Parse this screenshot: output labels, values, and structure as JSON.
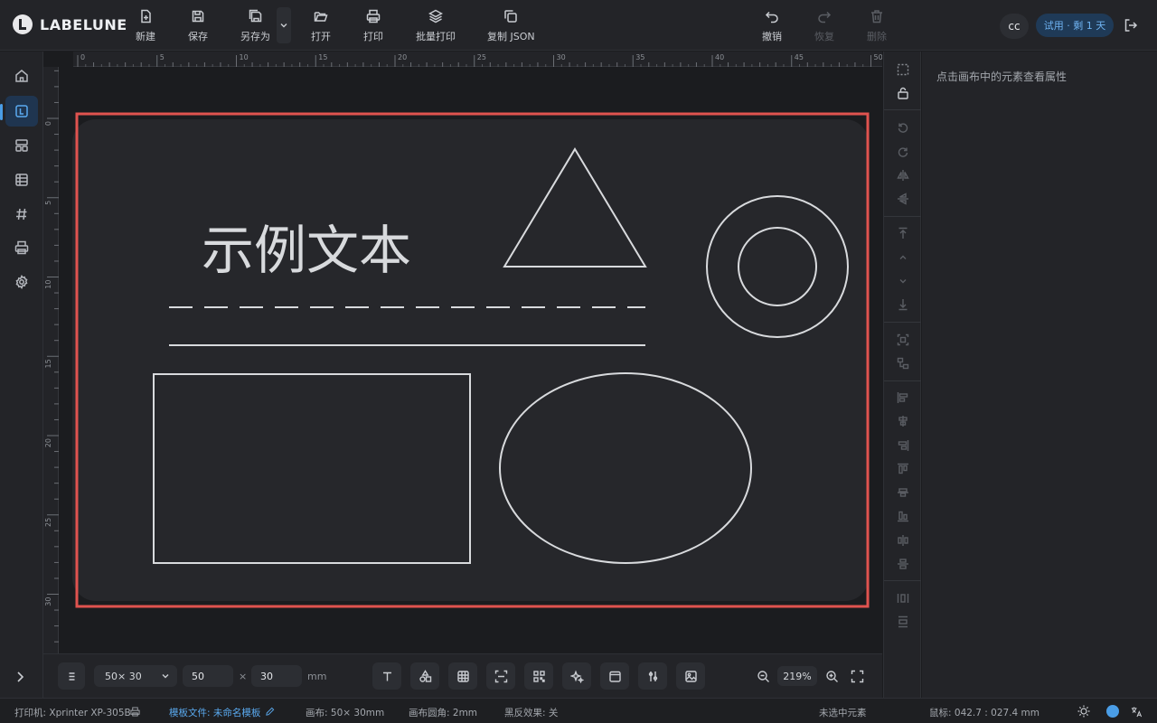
{
  "app": {
    "brand": "LABELUNE"
  },
  "toolbar": {
    "new": "新建",
    "save": "保存",
    "save_as": "另存为",
    "open": "打开",
    "print": "打印",
    "batch_print": "批量打印",
    "copy_json": "复制 JSON",
    "undo": "撤销",
    "redo": "恢复",
    "delete": "删除"
  },
  "user": {
    "initials": "cc",
    "trial": "试用 · 剩 1 天"
  },
  "left_nav": [
    "home-icon",
    "label-icon",
    "template-icon",
    "table-icon",
    "hash-icon",
    "printer-icon",
    "settings-icon"
  ],
  "canvas": {
    "sample_text": "示例文本",
    "ruler_top_labels": [
      "0",
      "5",
      "10",
      "15",
      "20",
      "25",
      "30",
      "35",
      "40",
      "45",
      "50"
    ],
    "ruler_left_labels": [
      "0",
      "5",
      "10",
      "15",
      "20",
      "25",
      "30"
    ],
    "border_color": "#e0534f"
  },
  "props": {
    "hint": "点击画布中的元素查看属性"
  },
  "bottom": {
    "size_preset": "50× 30",
    "width": "50",
    "times": "×",
    "height": "30",
    "unit": "mm",
    "zoom": "219%"
  },
  "status": {
    "printer_label": "打印机:",
    "printer_value": "Xprinter XP-305B",
    "template_label": "模板文件:",
    "template_value": "未命名模板",
    "canvas_label": "画布:",
    "canvas_value": "50× 30mm",
    "radius_label": "画布圆角:",
    "radius_value": "2mm",
    "invert_label": "黑反效果:",
    "invert_value": "关",
    "selection": "未选中元素",
    "mouse_label": "鼠标:",
    "mouse_value": "042.7 : 027.4 mm"
  }
}
